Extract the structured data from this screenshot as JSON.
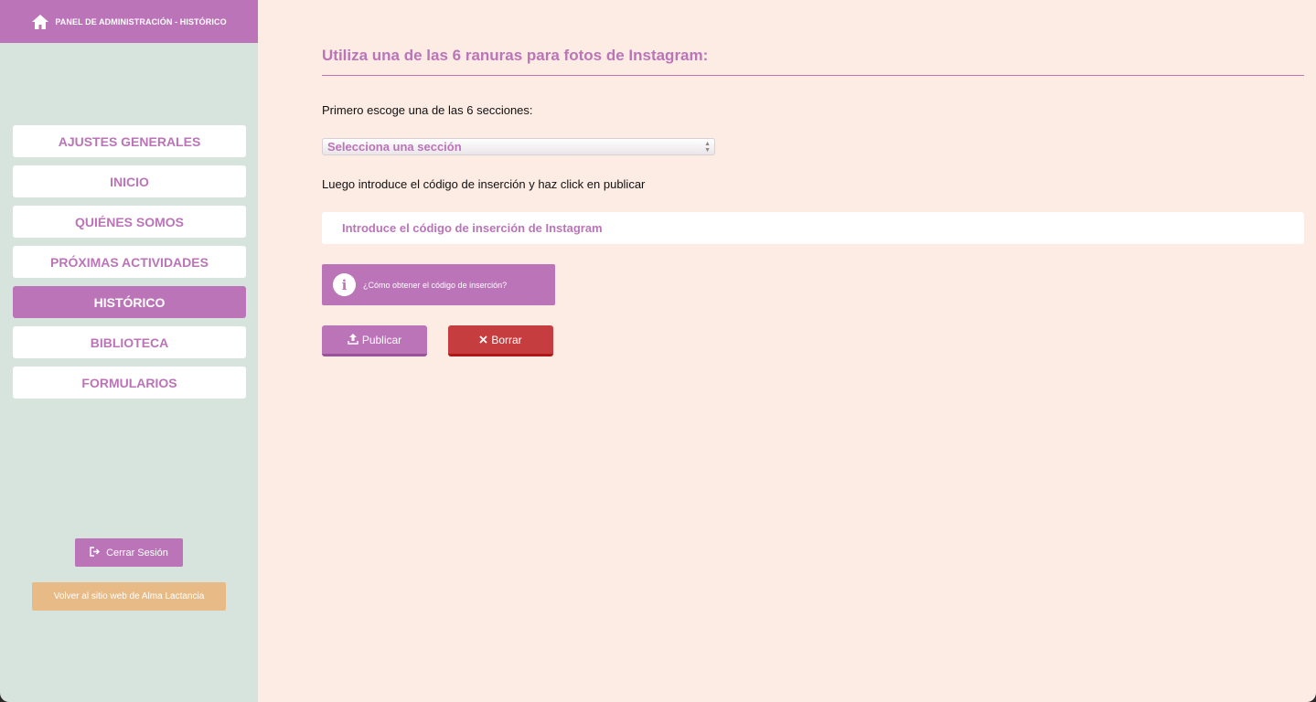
{
  "sidebar": {
    "header_title": "PANEL DE ADMINISTRACIÓN - HISTÓRICO",
    "items": [
      {
        "label": "AJUSTES GENERALES"
      },
      {
        "label": "INICIO"
      },
      {
        "label": "QUIÉNES SOMOS"
      },
      {
        "label": "PRÓXIMAS ACTIVIDADES"
      },
      {
        "label": "HISTÓRICO",
        "active": true
      },
      {
        "label": "BIBLIOTECA"
      },
      {
        "label": "FORMULARIOS"
      }
    ],
    "logout_label": "Cerrar Sesión",
    "back_label": "Volver al sitio web de Alma Lactancia"
  },
  "main": {
    "heading": "Utiliza una de las 6 ranuras para fotos de Instagram:",
    "step1": "Primero escoge una de las 6 secciones:",
    "select_value": "Selecciona una sección",
    "step2": "Luego introduce el código de inserción y haz click en publicar",
    "embed_placeholder": "Introduce el código de inserción de Instagram",
    "info_text": "¿Cómo obtener el código de inserción?",
    "publish_label": "Publicar",
    "delete_label": "Borrar"
  },
  "colors": {
    "accent": "#bb74b8",
    "sidebar_bg": "#d7e4de",
    "main_bg": "#fdece4",
    "danger": "#c53d3e",
    "secondary": "#e8bb86"
  },
  "icons": {
    "home": "home-icon",
    "logout": "logout-icon",
    "info": "info-icon",
    "upload": "upload-icon",
    "close": "close-icon"
  }
}
